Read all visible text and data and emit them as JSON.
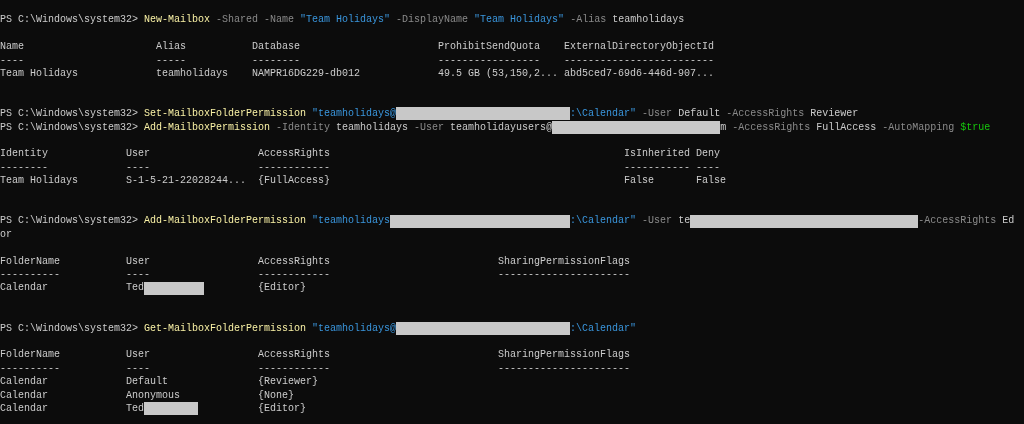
{
  "blocks": [
    {
      "kind": "command",
      "segments": [
        {
          "kind": "prompt",
          "text": "PS C:\\Windows\\system32>"
        },
        {
          "kind": "cmdlet",
          "text": "New-Mailbox"
        },
        {
          "kind": "param",
          "text": "-Shared"
        },
        {
          "kind": "param",
          "text": "-Name"
        },
        {
          "kind": "string",
          "text": "\"Team Holidays\""
        },
        {
          "kind": "param",
          "text": "-DisplayName"
        },
        {
          "kind": "string",
          "text": "\"Team Holidays\""
        },
        {
          "kind": "param",
          "text": "-Alias"
        },
        {
          "kind": "plain",
          "text": "teamholidays"
        }
      ]
    },
    {
      "kind": "table",
      "columns": [
        {
          "header": "Name",
          "underline": "----"
        },
        {
          "header": "Alias",
          "underline": "-----"
        },
        {
          "header": "Database",
          "underline": "--------"
        },
        {
          "header": "ProhibitSendQuota",
          "underline": "-----------------"
        },
        {
          "header": "ExternalDirectoryObjectId",
          "underline": "-------------------------"
        }
      ],
      "rows": [
        [
          {
            "text": "Team Holidays",
            "redacted": false
          },
          {
            "text": "teamholidays",
            "redacted": false
          },
          {
            "text": "NAMPR16DG229-db012",
            "redacted": false
          },
          {
            "text": "49.5 GB (53,150,2...",
            "redacted": false
          },
          {
            "text": "abd5ced7-69d6-446d-907...",
            "redacted": false
          }
        ]
      ]
    },
    {
      "kind": "command",
      "segments": [
        {
          "kind": "prompt",
          "text": "PS C:\\Windows\\system32>"
        },
        {
          "kind": "cmdlet",
          "text": "Set-MailboxFolderPermission"
        },
        {
          "kind": "string",
          "text": "\"teamholidays@"
        },
        {
          "kind": "redacted"
        },
        {
          "kind": "string",
          "text": ":\\Calendar\""
        },
        {
          "kind": "param",
          "text": "-User"
        },
        {
          "kind": "plain",
          "text": "Default"
        },
        {
          "kind": "param",
          "text": "-AccessRights"
        },
        {
          "kind": "plain",
          "text": "Reviewer"
        }
      ]
    },
    {
      "kind": "command",
      "segments": [
        {
          "kind": "prompt",
          "text": "PS C:\\Windows\\system32>"
        },
        {
          "kind": "cmdlet",
          "text": "Add-MailboxPermission"
        },
        {
          "kind": "param",
          "text": "-Identity"
        },
        {
          "kind": "plain",
          "text": "teamholidays"
        },
        {
          "kind": "param",
          "text": "-User"
        },
        {
          "kind": "plain",
          "text": "teamholidayusers@"
        },
        {
          "kind": "redacted"
        },
        {
          "kind": "plain",
          "text": "m"
        },
        {
          "kind": "param",
          "text": "-AccessRights"
        },
        {
          "kind": "plain",
          "text": "FullAccess"
        },
        {
          "kind": "param",
          "text": "-AutoMapping"
        },
        {
          "kind": "variable",
          "text": "$true"
        }
      ]
    },
    {
      "kind": "table",
      "columns": [
        {
          "header": "Identity",
          "underline": "--------"
        },
        {
          "header": "User",
          "underline": "----"
        },
        {
          "header": "AccessRights",
          "underline": "------------"
        },
        {
          "header": "IsInherited",
          "underline": "-----------"
        },
        {
          "header": "Deny",
          "underline": "----"
        }
      ],
      "rows": [
        [
          {
            "text": "Team Holidays",
            "redacted": false
          },
          {
            "text": "S-1-5-21-22028244...",
            "redacted": false
          },
          {
            "text": "{FullAccess}",
            "redacted": false
          },
          {
            "text": "False",
            "redacted": false
          },
          {
            "text": "False",
            "redacted": false
          }
        ]
      ]
    },
    {
      "kind": "command",
      "segments": [
        {
          "kind": "prompt",
          "text": "PS C:\\Windows\\system32>"
        },
        {
          "kind": "cmdlet",
          "text": "Add-MailboxFolderPermission"
        },
        {
          "kind": "string",
          "text": "\"teamholidays"
        },
        {
          "kind": "redacted"
        },
        {
          "kind": "string",
          "text": ":\\Calendar\""
        },
        {
          "kind": "param",
          "text": "-User"
        },
        {
          "kind": "plain",
          "text": "te"
        },
        {
          "kind": "redacted"
        },
        {
          "kind": "param",
          "text": "-AccessRights"
        },
        {
          "kind": "plain",
          "text": "Ed"
        }
      ]
    },
    {
      "kind": "text",
      "text": "or"
    },
    {
      "kind": "table",
      "columns": [
        {
          "header": "FolderName",
          "underline": "----------"
        },
        {
          "header": "User",
          "underline": "----"
        },
        {
          "header": "AccessRights",
          "underline": "------------"
        },
        {
          "header": "SharingPermissionFlags",
          "underline": "----------------------"
        }
      ],
      "rows": [
        [
          {
            "text": "Calendar",
            "redacted": false
          },
          {
            "text": "Ted",
            "redacted": true
          },
          {
            "text": "{Editor}",
            "redacted": false
          }
        ]
      ]
    },
    {
      "kind": "command",
      "segments": [
        {
          "kind": "prompt",
          "text": "PS C:\\Windows\\system32>"
        },
        {
          "kind": "cmdlet",
          "text": "Get-MailboxFolderPermission"
        },
        {
          "kind": "string",
          "text": "\"teamholidays@"
        },
        {
          "kind": "redacted"
        },
        {
          "kind": "string",
          "text": ":\\Calendar\""
        }
      ]
    },
    {
      "kind": "table",
      "columns": [
        {
          "header": "FolderName",
          "underline": "----------"
        },
        {
          "header": "User",
          "underline": "----"
        },
        {
          "header": "AccessRights",
          "underline": "------------"
        },
        {
          "header": "SharingPermissionFlags",
          "underline": "----------------------"
        }
      ],
      "rows": [
        [
          {
            "text": "Calendar",
            "redacted": false
          },
          {
            "text": "Default",
            "redacted": false
          },
          {
            "text": "{Reviewer}",
            "redacted": false
          }
        ],
        [
          {
            "text": "Calendar",
            "redacted": false
          },
          {
            "text": "Anonymous",
            "redacted": false
          },
          {
            "text": "{None}",
            "redacted": false
          }
        ],
        [
          {
            "text": "Calendar",
            "redacted": false
          },
          {
            "text": "Ted",
            "redacted": true
          },
          {
            "text": "{Editor}",
            "redacted": false
          }
        ]
      ]
    }
  ]
}
